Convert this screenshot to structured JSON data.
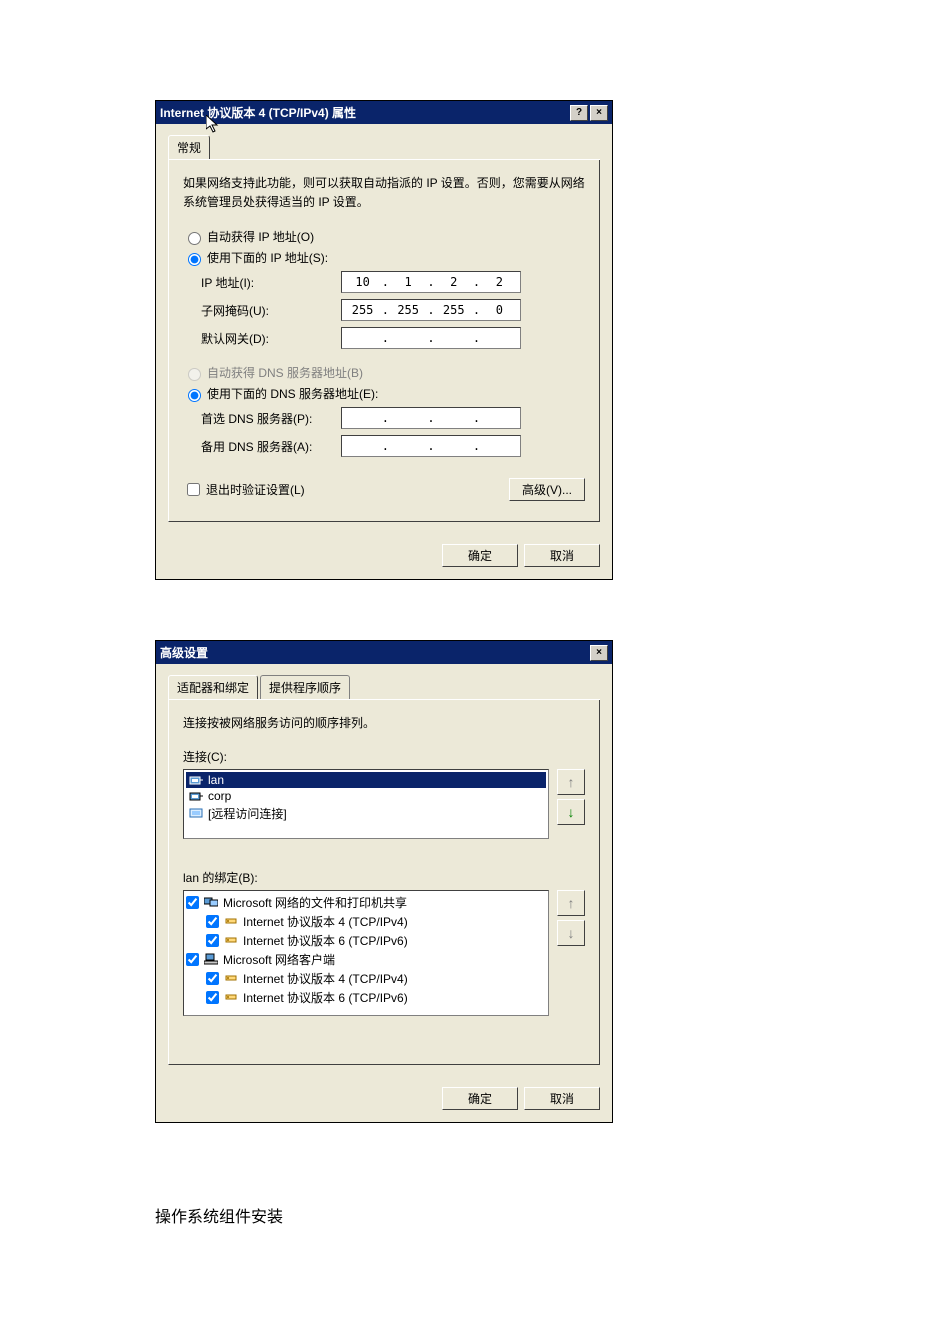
{
  "dialog1": {
    "title": "Internet 协议版本 4 (TCP/IPv4) 属性",
    "help_btn": "?",
    "close_btn": "×",
    "tab_general": "常规",
    "description": "如果网络支持此功能，则可以获取自动指派的 IP 设置。否则，您需要从网络系统管理员处获得适当的 IP 设置。",
    "radio_auto_ip": "自动获得 IP 地址(O)",
    "radio_manual_ip": "使用下面的 IP 地址(S):",
    "label_ip": "IP 地址(I):",
    "ip": [
      "10",
      "1",
      "2",
      "2"
    ],
    "label_mask": "子网掩码(U):",
    "mask": [
      "255",
      "255",
      "255",
      "0"
    ],
    "label_gateway": "默认网关(D):",
    "gateway": [
      "",
      "",
      "",
      ""
    ],
    "radio_auto_dns": "自动获得 DNS 服务器地址(B)",
    "radio_manual_dns": "使用下面的 DNS 服务器地址(E):",
    "label_dns1": "首选 DNS 服务器(P):",
    "dns1": [
      "",
      "",
      "",
      ""
    ],
    "label_dns2": "备用 DNS 服务器(A):",
    "dns2": [
      "",
      "",
      "",
      ""
    ],
    "chk_validate": "退出时验证设置(L)",
    "btn_advanced": "高级(V)...",
    "btn_ok": "确定",
    "btn_cancel": "取消"
  },
  "dialog2": {
    "title": "高级设置",
    "close_btn": "×",
    "tab_adapter": "适配器和绑定",
    "tab_provider": "提供程序顺序",
    "desc": "连接按被网络服务访问的顺序排列。",
    "label_conn": "连接(C):",
    "connections": [
      {
        "name": "lan",
        "selected": true,
        "icon": "network-adapter-icon"
      },
      {
        "name": "corp",
        "selected": false,
        "icon": "network-adapter-icon"
      },
      {
        "name": "[远程访问连接]",
        "selected": false,
        "icon": "remote-access-icon"
      }
    ],
    "label_bind": "lan 的绑定(B):",
    "bindings": [
      {
        "level": 0,
        "checked": true,
        "icon": "file-share-icon",
        "text": "Microsoft 网络的文件和打印机共享"
      },
      {
        "level": 1,
        "checked": true,
        "icon": "protocol-icon",
        "text": "Internet 协议版本 4 (TCP/IPv4)"
      },
      {
        "level": 1,
        "checked": true,
        "icon": "protocol-icon",
        "text": "Internet 协议版本 6 (TCP/IPv6)"
      },
      {
        "level": 0,
        "checked": true,
        "icon": "client-icon",
        "text": "Microsoft 网络客户端"
      },
      {
        "level": 1,
        "checked": true,
        "icon": "protocol-icon",
        "text": "Internet 协议版本 4 (TCP/IPv4)"
      },
      {
        "level": 1,
        "checked": true,
        "icon": "protocol-icon",
        "text": "Internet 协议版本 6 (TCP/IPv6)"
      }
    ],
    "btn_ok": "确定",
    "btn_cancel": "取消",
    "arrow_up": "↑",
    "arrow_down": "↓"
  },
  "footer_text": "操作系统组件安装"
}
